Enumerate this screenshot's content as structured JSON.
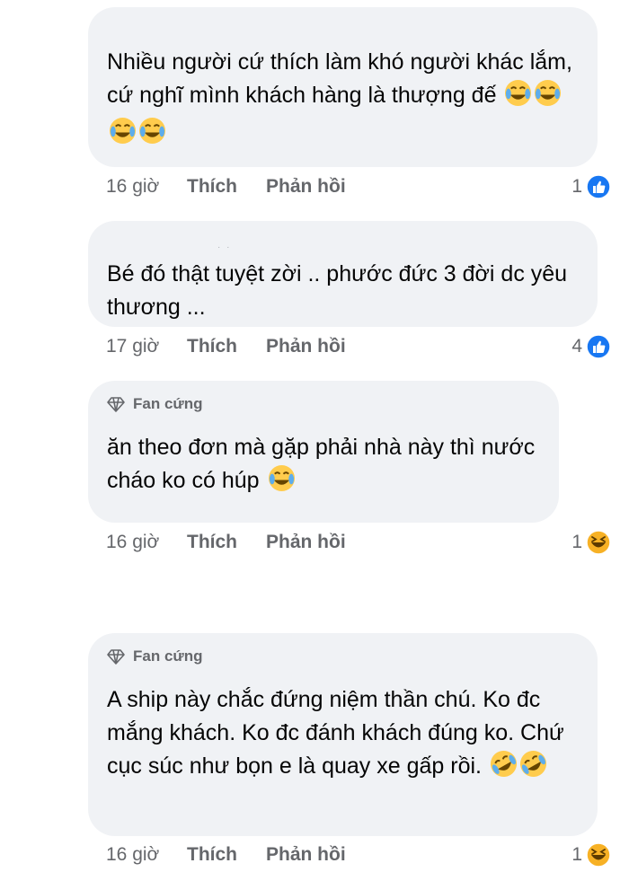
{
  "comments": [
    {
      "badge": "",
      "text": "Nhiều người cứ thích làm khó người khác lắm, cứ nghĩ mình khách hàng là thượng đế",
      "emojis": [
        "joy-emoji",
        "joy-emoji",
        "joy-emoji",
        "joy-emoji"
      ],
      "time": "16 giờ",
      "like_label": "Thích",
      "reply_label": "Phản hồi",
      "reaction_count": "1",
      "reaction_icon": "like-icon"
    },
    {
      "badge": "",
      "text": "Bé đó thật tuyệt zời .. phước đức 3 đời dc yêu thương ...",
      "emojis": [],
      "time": "17 giờ",
      "like_label": "Thích",
      "reply_label": "Phản hồi",
      "reaction_count": "4",
      "reaction_icon": "like-icon"
    },
    {
      "badge": "Fan cứng",
      "text": "ăn theo đơn mà gặp phải nhà này thì nước cháo ko có húp",
      "emojis": [
        "joy-emoji"
      ],
      "time": "16 giờ",
      "like_label": "Thích",
      "reply_label": "Phản hồi",
      "reaction_count": "1",
      "reaction_icon": "haha-icon"
    },
    {
      "badge": "Fan cứng",
      "text": "A ship này chắc đứng niệm thần chú. Ko đc mắng khách. Ko đc đánh khách đúng ko. Chứ cục súc như bọn e là quay xe gấp rồi.",
      "emojis": [
        "rofl-emoji",
        "rofl-emoji"
      ],
      "time": "16 giờ",
      "like_label": "Thích",
      "reply_label": "Phản hồi",
      "reaction_count": "1",
      "reaction_icon": "haha-icon"
    }
  ],
  "colors": {
    "bubble": "#f0f2f5",
    "meta_text": "#65676b",
    "like_blue": "#1877f2",
    "haha_yellow": "#f7b125"
  }
}
